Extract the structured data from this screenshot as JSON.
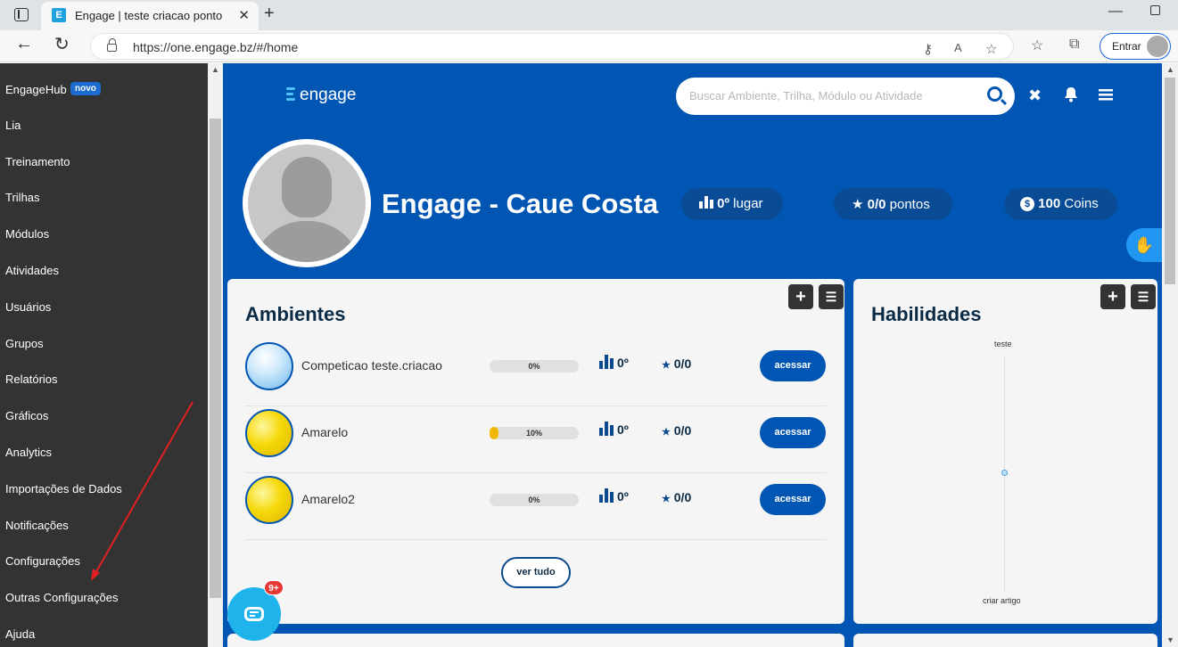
{
  "browser": {
    "tab_title": "Engage | teste criacao ponto",
    "url": "https://one.engage.bz/#/home",
    "signin_label": "Entrar"
  },
  "sidebar": {
    "items": [
      {
        "label": "EngageHub",
        "badge": "novo"
      },
      {
        "label": "Lia"
      },
      {
        "label": "Treinamento"
      },
      {
        "label": "Trilhas"
      },
      {
        "label": "Módulos"
      },
      {
        "label": "Atividades"
      },
      {
        "label": "Usuários"
      },
      {
        "label": "Grupos"
      },
      {
        "label": "Relatórios"
      },
      {
        "label": "Gráficos"
      },
      {
        "label": "Analytics"
      },
      {
        "label": "Importações de Dados"
      },
      {
        "label": "Notificações"
      },
      {
        "label": "Configurações"
      },
      {
        "label": "Outras Configurações"
      },
      {
        "label": "Ajuda"
      }
    ]
  },
  "header": {
    "logo_text": "engage",
    "search_placeholder": "Buscar Ambiente, Trilha, Módulo ou Atividade"
  },
  "profile": {
    "name": "Engage - Caue Costa",
    "ranking": "0º",
    "ranking_label": "lugar",
    "points": "0/0",
    "points_label": "pontos",
    "coins": "100",
    "coins_label": "Coins"
  },
  "ambientes": {
    "title": "Ambientes",
    "rows": [
      {
        "name": "Competicao teste.criacao",
        "progress": 0,
        "progress_label": "0%",
        "rank": "0º",
        "score": "0/0",
        "button": "acessar",
        "thumb": "sky"
      },
      {
        "name": "Amarelo",
        "progress": 10,
        "progress_label": "10%",
        "rank": "0º",
        "score": "0/0",
        "button": "acessar",
        "thumb": "yellow"
      },
      {
        "name": "Amarelo2",
        "progress": 0,
        "progress_label": "0%",
        "rank": "0º",
        "score": "0/0",
        "button": "acessar",
        "thumb": "yellow"
      }
    ],
    "see_all": "ver tudo"
  },
  "habilidades": {
    "title": "Habilidades",
    "skills": [
      {
        "name": "teste",
        "value": 0.5
      },
      {
        "name": "criar artigo",
        "value": 0.5
      }
    ]
  },
  "chat": {
    "badge": "9+"
  },
  "colors": {
    "primary": "#0256b3",
    "sidebar": "#333333",
    "accent": "#f2b705"
  }
}
